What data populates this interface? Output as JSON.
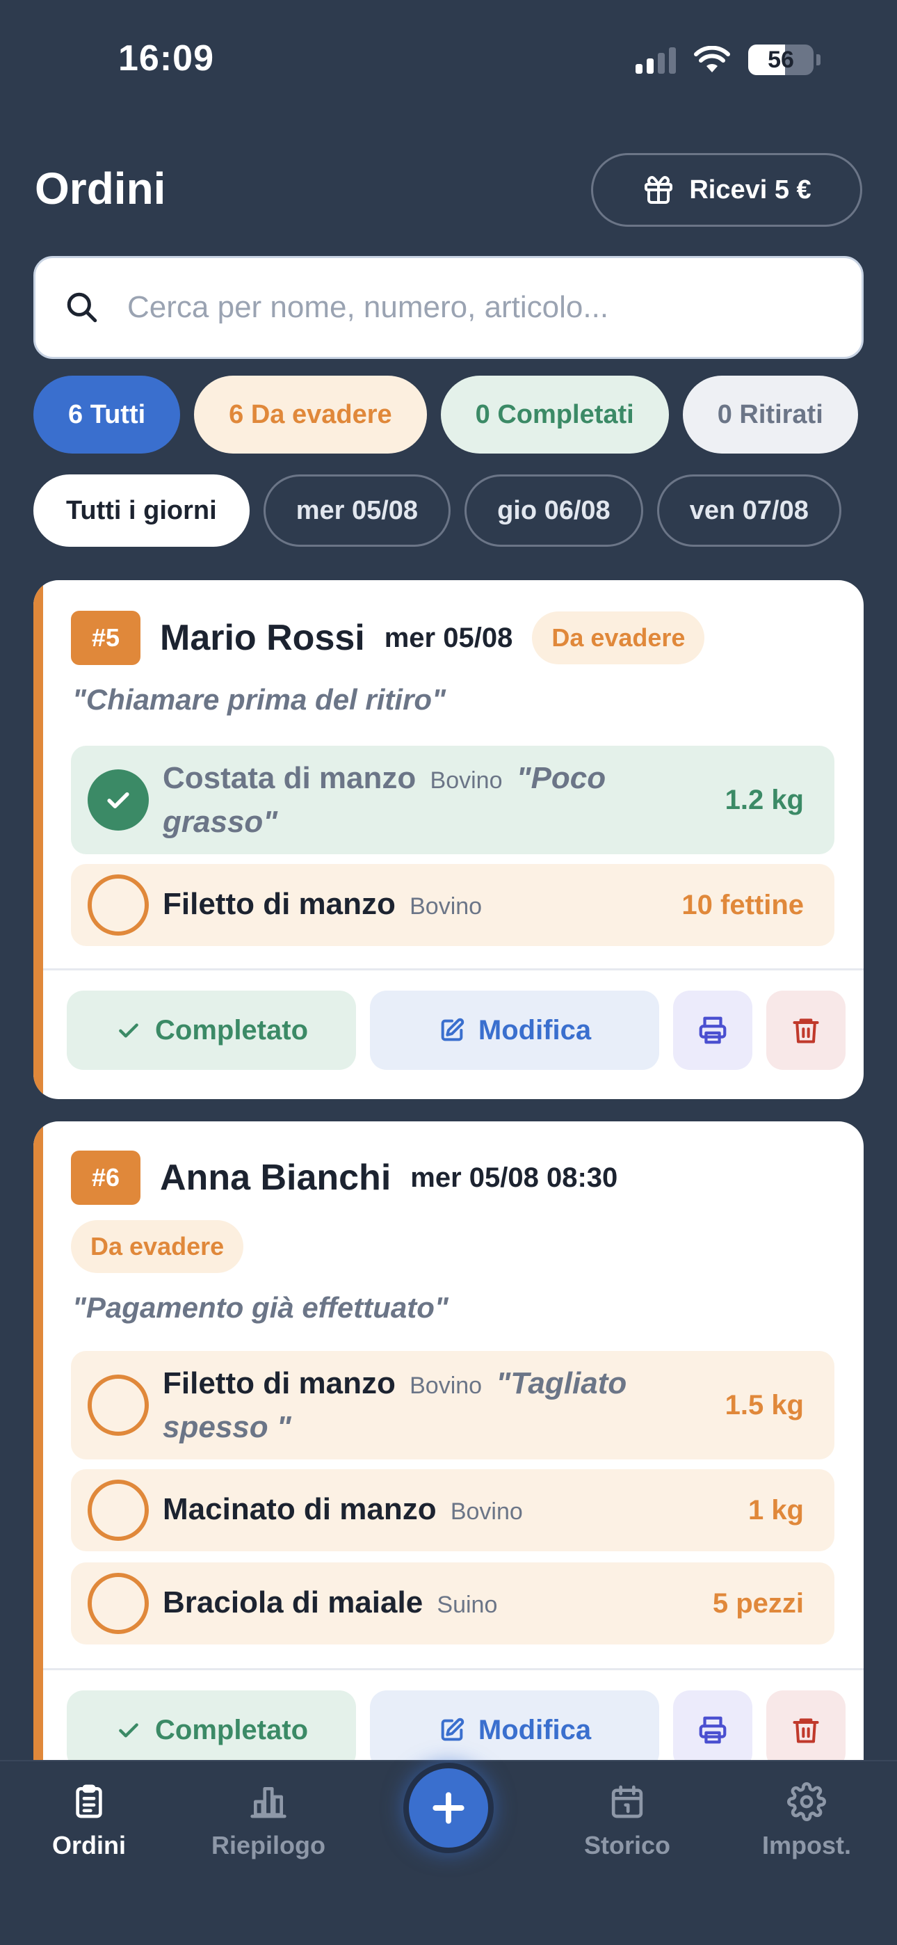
{
  "status_bar": {
    "time": "16:09",
    "battery": "56"
  },
  "header": {
    "title": "Ordini",
    "promo_label": "Ricevi 5 €"
  },
  "search": {
    "placeholder": "Cerca per nome, numero, articolo..."
  },
  "status_filters": [
    {
      "label": "6 Tutti"
    },
    {
      "label": "6 Da evadere"
    },
    {
      "label": "0 Completati"
    },
    {
      "label": "0 Ritirati"
    }
  ],
  "day_filters": [
    {
      "label": "Tutti i giorni"
    },
    {
      "label": "mer 05/08"
    },
    {
      "label": "gio 06/08"
    },
    {
      "label": "ven 07/08"
    }
  ],
  "orders": [
    {
      "number": "#5",
      "customer": "Mario Rossi",
      "date": "mer 05/08",
      "status": "Da evadere",
      "note": "\"Chiamare prima del ritiro\"",
      "items": [
        {
          "name": "Costata di manzo",
          "category": "Bovino",
          "note": "\"Poco grasso\"",
          "qty": "1.2 kg",
          "done": true
        },
        {
          "name": "Filetto di manzo",
          "category": "Bovino",
          "note": "",
          "qty": "10 fettine",
          "done": false
        }
      ]
    },
    {
      "number": "#6",
      "customer": "Anna Bianchi",
      "date": "mer 05/08 08:30",
      "status": "Da evadere",
      "note": "\"Pagamento già effettuato\"",
      "items": [
        {
          "name": "Filetto di manzo",
          "category": "Bovino",
          "note": "\"Tagliato spesso \"",
          "qty": "1.5 kg",
          "done": false
        },
        {
          "name": "Macinato di manzo",
          "category": "Bovino",
          "note": "",
          "qty": "1 kg",
          "done": false
        },
        {
          "name": "Braciola di maiale",
          "category": "Suino",
          "note": "",
          "qty": "5 pezzi",
          "done": false
        }
      ]
    }
  ],
  "actions": {
    "complete_label": "Completato",
    "edit_label": "Modifica"
  },
  "nav": {
    "items": [
      {
        "label": "Ordini",
        "icon": "clipboard-icon"
      },
      {
        "label": "Riepilogo",
        "icon": "bar-chart-icon"
      },
      {
        "label": "Storico",
        "icon": "calendar-icon"
      },
      {
        "label": "Impost.",
        "icon": "gear-icon"
      }
    ],
    "fab_icon": "plus-icon"
  },
  "colors": {
    "background": "#2e3b4e",
    "accent": "#3a6fce",
    "pending": "#e0883a",
    "completed": "#3b8a66",
    "danger": "#c0392b"
  }
}
